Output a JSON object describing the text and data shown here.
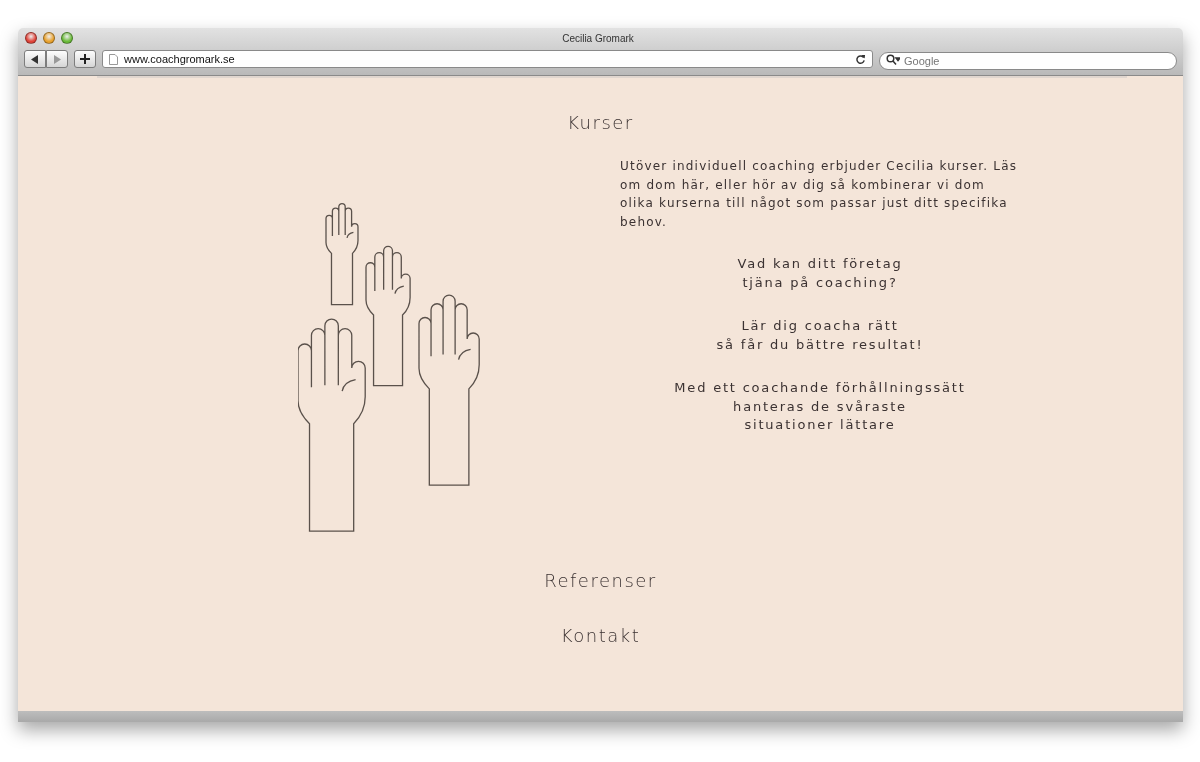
{
  "window": {
    "title": "Cecilia Gromark"
  },
  "toolbar": {
    "address": "www.coachgromark.se",
    "search": {
      "placeholder": "Google"
    }
  },
  "page": {
    "heading": "Kurser",
    "intro": "Utöver individuell coaching erbjuder Cecilia kurser. Läs om dom här, eller hör av dig så kombinerar vi dom olika kurserna till något som passar just ditt specifika behov.",
    "courses": [
      [
        "Vad kan ditt företag",
        "tjäna på coaching?"
      ],
      [
        "Lär dig coacha rätt",
        "så får du bättre resultat!"
      ],
      [
        "Med ett coachande förhållningssätt",
        "hanteras de svåraste",
        "situationer lättare"
      ]
    ],
    "sections": [
      "Referenser",
      "Kontakt"
    ]
  }
}
